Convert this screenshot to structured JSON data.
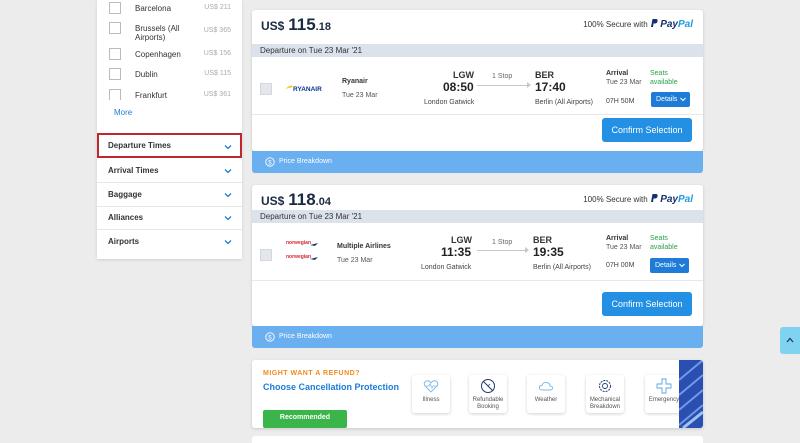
{
  "sidebar": {
    "destinations": [
      {
        "name": "Barcelona",
        "price": "US$ 211"
      },
      {
        "name": "Brussels (All Airports)",
        "price": "US$ 365"
      },
      {
        "name": "Copenhagen",
        "price": "US$ 156"
      },
      {
        "name": "Dublin",
        "price": "US$ 115"
      },
      {
        "name": "Frankfurt",
        "price": "US$ 361"
      }
    ],
    "more_label": "More",
    "filters": [
      "Departure Times",
      "Arrival Times",
      "Baggage",
      "Alliances",
      "Airports"
    ]
  },
  "secure_text": "100% Secure with",
  "paypal": {
    "part1": "Pay",
    "part2": "Pal"
  },
  "results": [
    {
      "currency": "US$",
      "price_int": "115",
      "price_dec": ".18",
      "departure_header": "Departure on Tue 23 Mar '21",
      "airline": "Ryanair",
      "logo": "RYANAIR",
      "date": "Tue 23 Mar",
      "from_code": "LGW",
      "dep_time": "08:50",
      "from_city": "London Gatwick",
      "stops": "1 Stop",
      "to_code": "BER",
      "arr_time": "17:40",
      "to_city": "Berlin (All Airports)",
      "arrival_label": "Arrival",
      "arrival_date": "Tue 23 Mar",
      "seats": "Seats available",
      "duration": "07H 50M",
      "details_label": "Details",
      "confirm_label": "Confirm Selection",
      "breakdown_label": "Price Breakdown"
    },
    {
      "currency": "US$",
      "price_int": "118",
      "price_dec": ".04",
      "departure_header": "Departure on Tue 23 Mar '21",
      "airline": "Multiple Airlines",
      "logo_top": "norwegian",
      "logo_bottom": "norwegian",
      "date": "Tue 23 Mar",
      "from_code": "LGW",
      "dep_time": "11:35",
      "from_city": "London Gatwick",
      "stops": "1 Stop",
      "to_code": "BER",
      "arr_time": "19:35",
      "to_city": "Berlin (All Airports)",
      "arrival_label": "Arrival",
      "arrival_date": "Tue 23 Mar",
      "seats": "Seats available",
      "duration": "07H 00M",
      "details_label": "Details",
      "confirm_label": "Confirm Selection",
      "breakdown_label": "Price Breakdown"
    }
  ],
  "refund": {
    "kicker": "MIGHT WANT A REFUND?",
    "heading": "Choose Cancellation Protection",
    "recommended": "Recommended",
    "features": [
      "Illness",
      "Refundable Booking",
      "Weather",
      "Mechanical Breakdown",
      "Emergency"
    ]
  },
  "colors": {
    "accent": "#1e7bd8",
    "confirm": "#2490e4",
    "breakdown": "#6aaff0",
    "seats": "#2aa14a",
    "active_border": "#c0262d"
  }
}
